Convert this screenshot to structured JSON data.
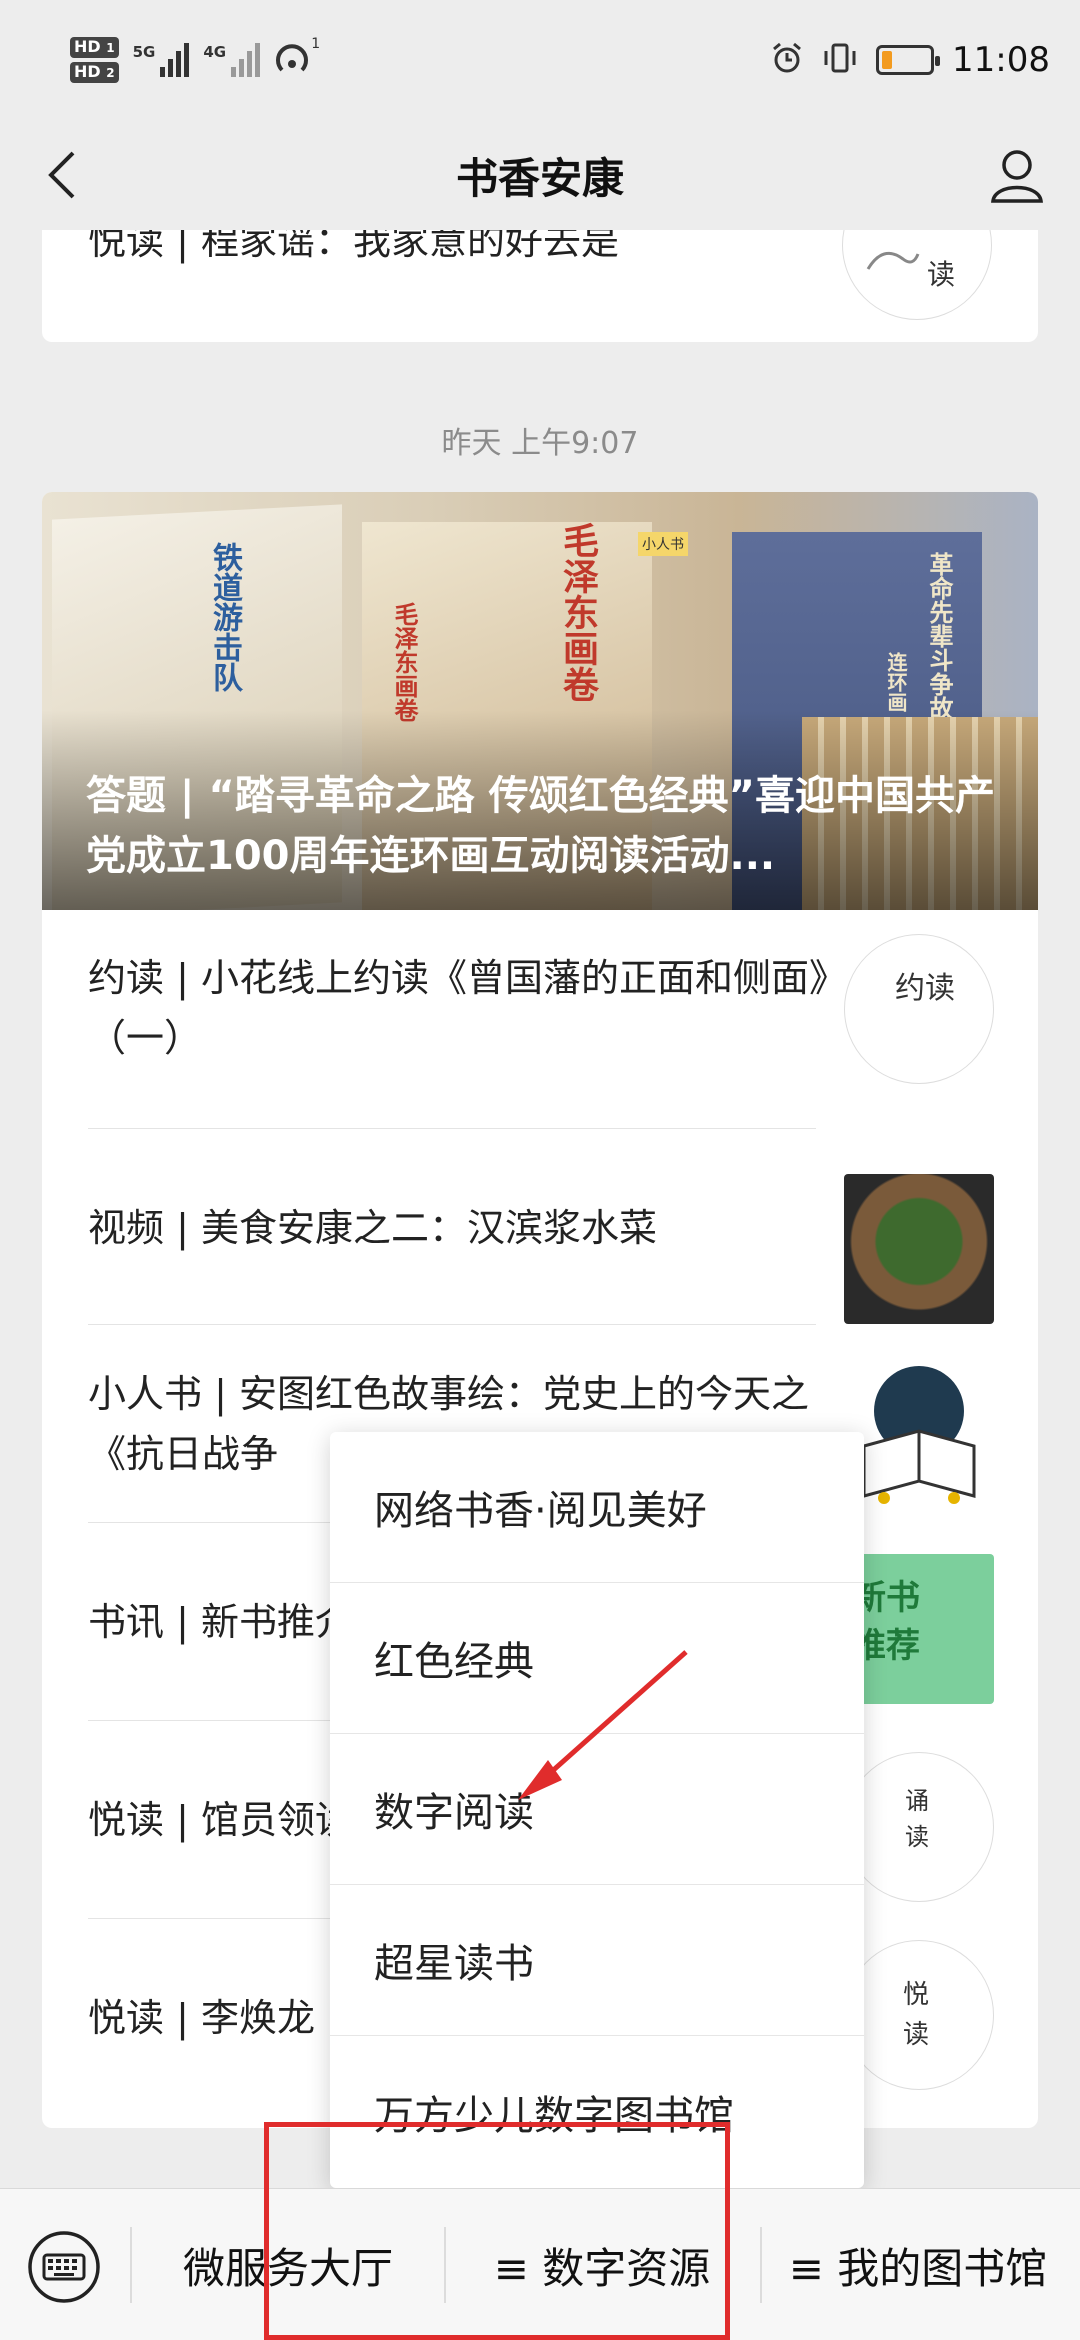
{
  "status_bar": {
    "hd1": "HD",
    "hd1_sub": "1",
    "hd2": "HD",
    "hd2_sub": "2",
    "net1": "5G",
    "net2": "4G",
    "wifi_sub": "1",
    "time": "11:08"
  },
  "header": {
    "title": "书香安康"
  },
  "top_card": {
    "partial_title": "悦读 | 程家谣：我家意的好去是",
    "thumb_text": "读"
  },
  "timestamp": "昨天 上午9:07",
  "main_article": {
    "cover_title": "答题 | “踏寻革命之路 传颂红色经典”喜迎中国共产党成立100周年连环画互动阅读活动...",
    "cover_texts": {
      "book1": "铁道游击队",
      "book2a": "毛泽东画卷",
      "book2b": "毛泽东画卷",
      "brand": "小人书",
      "book3": "革命先辈斗争故事",
      "book3b": "连环画"
    }
  },
  "articles": [
    {
      "title": "约读 | 小花线上约读《曾国藩的正面和侧面》（一）",
      "thumb": "约读"
    },
    {
      "title": "视频 | 美食安康之二：汉滨浆水菜",
      "thumb": ""
    },
    {
      "title": "小人书 | 安图红色故事绘：党史上的今天之《抗日战争",
      "thumb": ""
    },
    {
      "title": "书讯 | 新书推介",
      "thumb": "新书推荐"
    },
    {
      "title": "悦读 | 馆员领读行》",
      "thumb": "诵读"
    },
    {
      "title": "悦读 | 李焕龙",
      "thumb": "悦读"
    }
  ],
  "popup_menu": {
    "items": [
      "网络书香·阅见美好",
      "红色经典",
      "数字阅读",
      "超星读书",
      "万方少儿数字图书馆"
    ]
  },
  "bottom_bar": {
    "item1": "微服务大厅",
    "item2": "≡ 数字资源",
    "item3": "≡ 我的图书馆"
  },
  "colors": {
    "background": "#ededed",
    "annotation": "#e02c2c",
    "battery": "#f39b1f"
  }
}
